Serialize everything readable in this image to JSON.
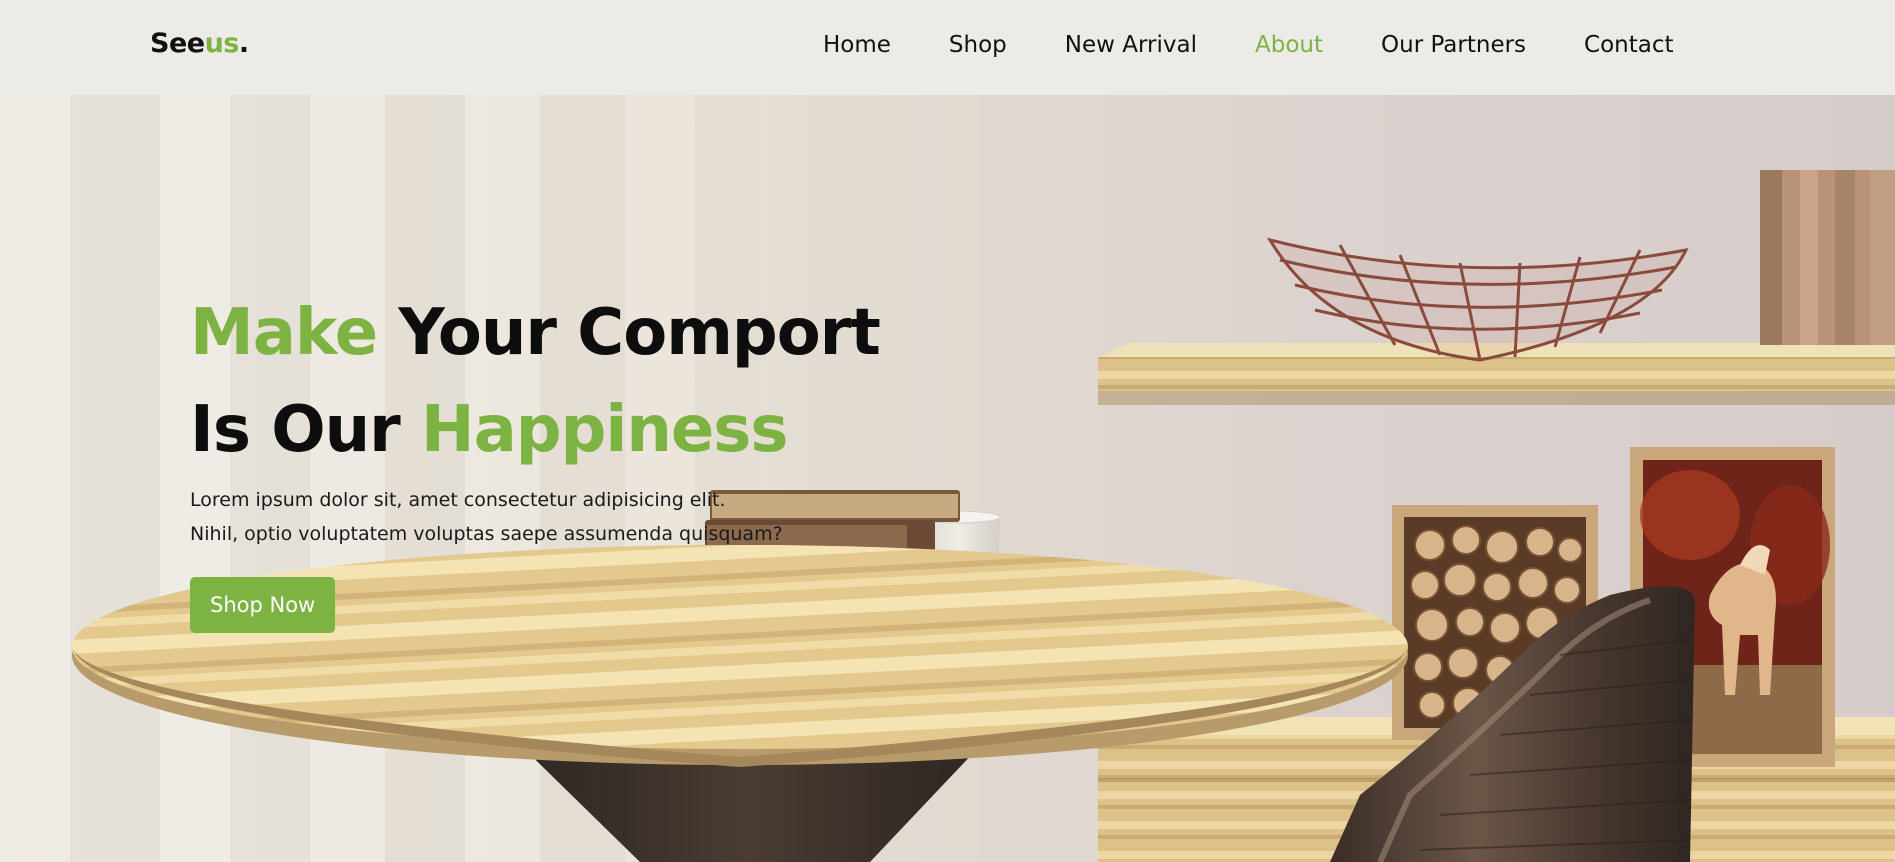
{
  "brand": {
    "prefix": "See",
    "accent": "us",
    "suffix": "."
  },
  "nav": {
    "items": [
      {
        "label": "Home",
        "active": false
      },
      {
        "label": "Shop",
        "active": false
      },
      {
        "label": "New Arrival",
        "active": false
      },
      {
        "label": "About",
        "active": true
      },
      {
        "label": "Our Partners",
        "active": false
      },
      {
        "label": "Contact",
        "active": false
      }
    ]
  },
  "hero": {
    "headline_line1": {
      "green": "Make",
      "rest": " Your Comport"
    },
    "headline_line2": {
      "rest": "Is Our ",
      "green": "Happiness"
    },
    "description_line1": "Lorem ipsum dolor sit, amet consectetur adipisicing elit.",
    "description_line2": "Nihil, optio voluptatem voluptas saepe assumenda quisquam?",
    "cta_label": "Shop Now"
  },
  "colors": {
    "accent": "#7cb342",
    "nav_bg": "#edebe8",
    "text": "#111111"
  }
}
